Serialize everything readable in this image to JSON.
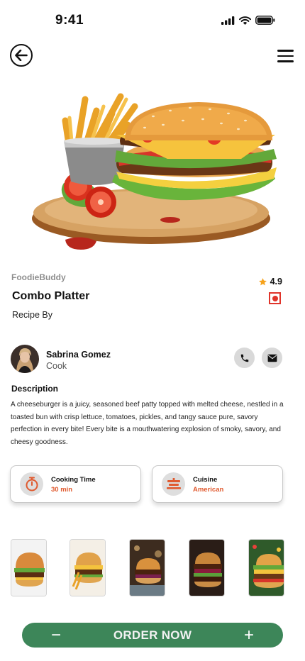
{
  "status_bar": {
    "time": "9:41"
  },
  "product": {
    "brand": "FoodieBuddy",
    "title": "Combo Platter",
    "recipe_by_label": "Recipe By",
    "rating": "4.9"
  },
  "author": {
    "name": "Sabrina Gomez",
    "role": "Cook"
  },
  "description": {
    "heading": "Description",
    "text": "A cheeseburger is a juicy, seasoned beef patty topped with melted cheese, nestled in a toasted bun with crisp lettuce, tomatoes, pickles, and tangy sauce pure, savory perfection in every bite! Every bite is a mouthwatering explosion of smoky, savory, and cheesy goodness."
  },
  "info_cards": [
    {
      "label": "Cooking Time",
      "value": "30 min",
      "icon": "stopwatch-icon"
    },
    {
      "label": "Cuisine",
      "value": "American",
      "icon": "serving-dish-icon"
    }
  ],
  "gallery_count": 5,
  "order": {
    "label": "ORDER NOW",
    "minus": "−",
    "plus": "+"
  },
  "colors": {
    "accent_green": "#3d8659",
    "accent_orange": "#e05a2f",
    "rating_star": "#f6a21b",
    "veg_mark_red": "#e0342a"
  }
}
